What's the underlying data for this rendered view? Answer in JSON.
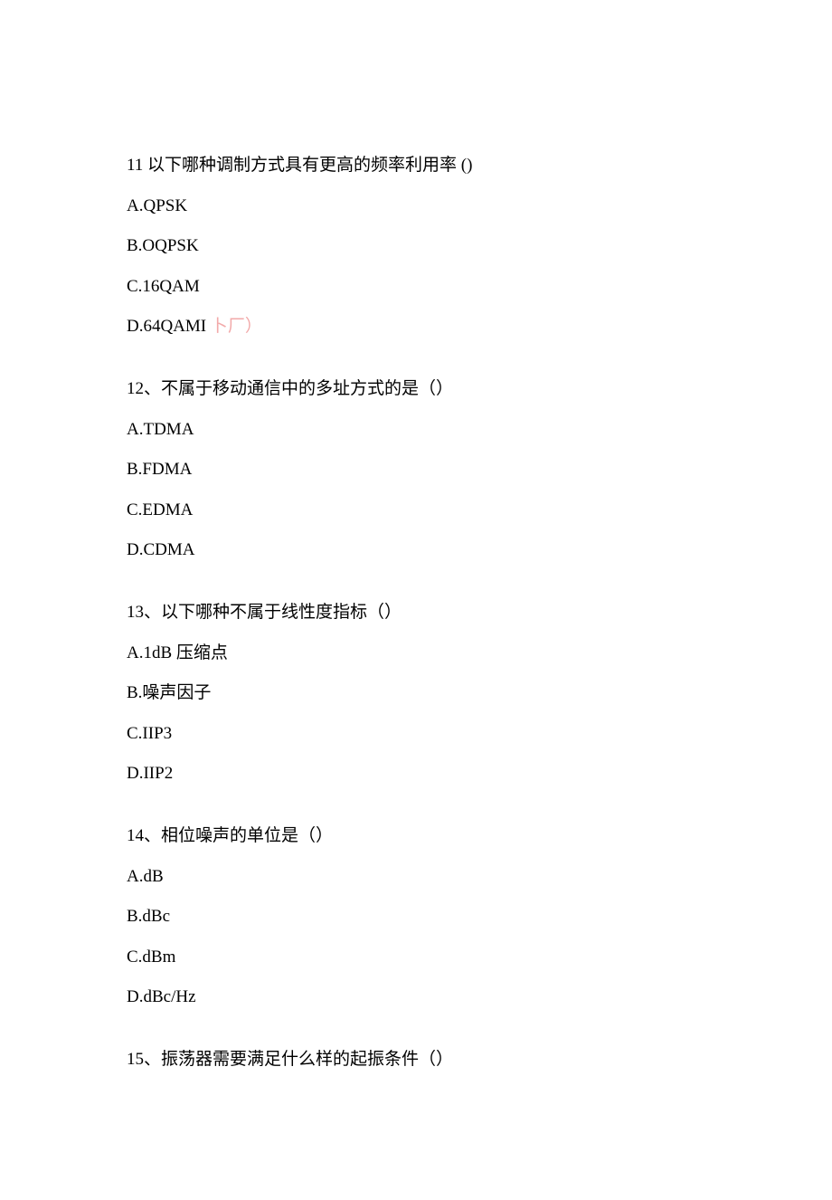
{
  "questions": [
    {
      "number": "11",
      "text": " 以下哪种调制方式具有更高的频率利用率 ()",
      "options": [
        {
          "label": "A.QPSK"
        },
        {
          "label": "B.OQPSK"
        },
        {
          "label": "C.16QAM"
        },
        {
          "label": "D.64QAMI",
          "annotation": " 卜厂）"
        }
      ]
    },
    {
      "number": "12",
      "text": "、不属于移动通信中的多址方式的是（）",
      "options": [
        {
          "label": "A.TDMA"
        },
        {
          "label": "B.FDMA"
        },
        {
          "label": "C.EDMA"
        },
        {
          "label": "D.CDMA"
        }
      ]
    },
    {
      "number": "13",
      "text": "、以下哪种不属于线性度指标（）",
      "options": [
        {
          "label": "A.1dB 压缩点"
        },
        {
          "label": "B.噪声因子"
        },
        {
          "label": "C.IIP3"
        },
        {
          "label": "D.IIP2"
        }
      ]
    },
    {
      "number": "14",
      "text": "、相位噪声的单位是（）",
      "options": [
        {
          "label": "A.dB"
        },
        {
          "label": "B.dBc"
        },
        {
          "label": "C.dBm"
        },
        {
          "label": "D.dBc/Hz"
        }
      ]
    },
    {
      "number": "15",
      "text": "、振荡器需要满足什么样的起振条件（）",
      "options": []
    }
  ]
}
